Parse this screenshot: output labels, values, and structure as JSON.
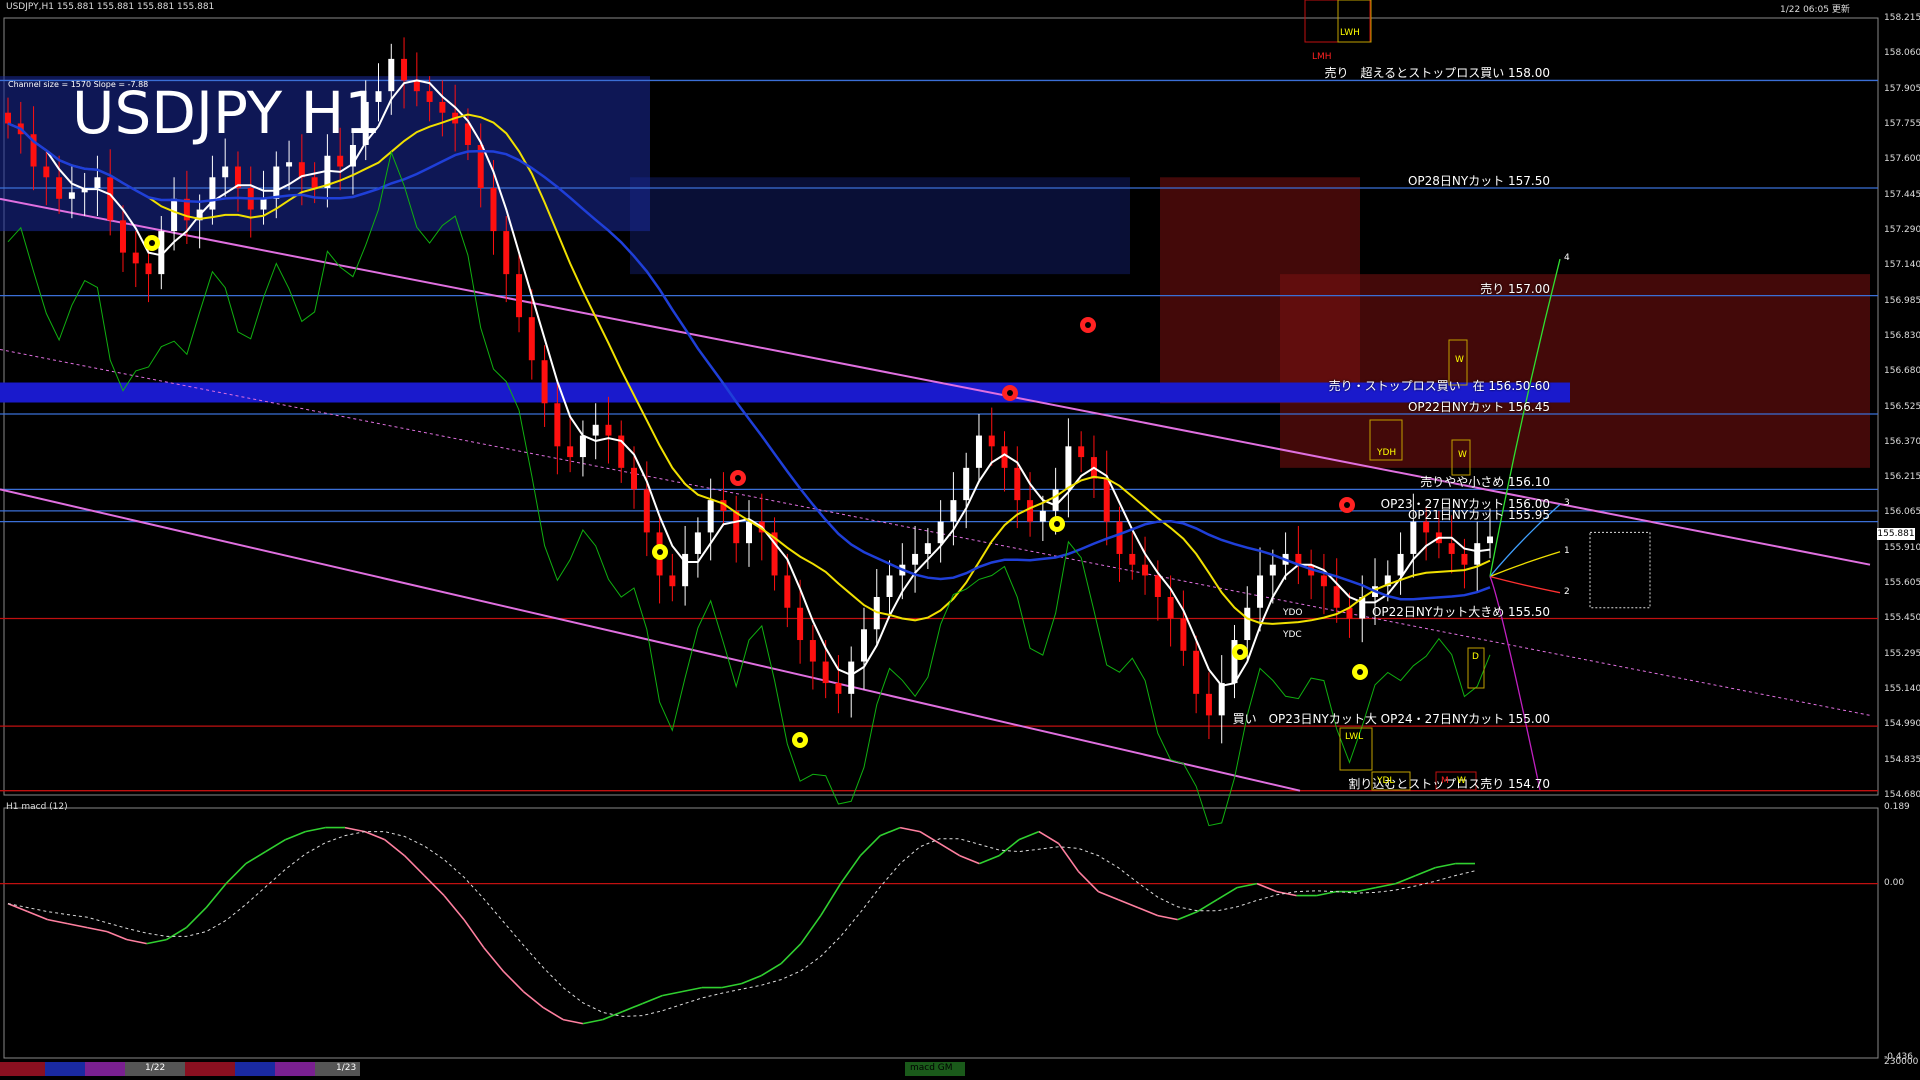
{
  "header": {
    "symbol": "USDJPY,H1  155.881 155.881 155.881 155.881",
    "clock": "1/22 06:05 更新",
    "title": "USDJPY H1",
    "channel_info": "Channel size = 1570 Slope = -7.88",
    "macd_label": "H1  macd (12)"
  },
  "chart_data": {
    "type": "line",
    "title": "USDJPY H1",
    "ylim": [
      154.68,
      158.29
    ],
    "macd_ylim": [
      -0.436,
      0.189
    ],
    "y_ticks": [
      "158.215",
      "158.060",
      "157.905",
      "157.755",
      "157.600",
      "157.445",
      "157.290",
      "157.140",
      "156.985",
      "156.830",
      "156.680",
      "156.525",
      "156.370",
      "156.215",
      "156.065",
      "155.910",
      "155.605",
      "155.450",
      "155.295",
      "155.140",
      "154.990",
      "154.835",
      "154.680"
    ],
    "current_price": "155.881",
    "macd_ticks": [
      "0.189",
      "0.00",
      "-0.436",
      "230000"
    ],
    "close_prices": [
      157.8,
      157.75,
      157.6,
      157.55,
      157.45,
      157.48,
      157.5,
      157.55,
      157.35,
      157.2,
      157.15,
      157.1,
      157.3,
      157.45,
      157.35,
      157.4,
      157.55,
      157.6,
      157.5,
      157.4,
      157.45,
      157.6,
      157.62,
      157.55,
      157.5,
      157.65,
      157.6,
      157.7,
      157.9,
      157.95,
      158.1,
      158.0,
      157.95,
      157.9,
      157.85,
      157.8,
      157.7,
      157.5,
      157.3,
      157.1,
      156.9,
      156.7,
      156.5,
      156.3,
      156.25,
      156.35,
      156.4,
      156.35,
      156.2,
      156.1,
      155.9,
      155.7,
      155.65,
      155.8,
      155.9,
      156.05,
      156.0,
      155.85,
      155.95,
      155.9,
      155.7,
      155.55,
      155.4,
      155.3,
      155.2,
      155.15,
      155.3,
      155.45,
      155.6,
      155.7,
      155.75,
      155.8,
      155.85,
      155.95,
      156.05,
      156.2,
      156.35,
      156.3,
      156.2,
      156.05,
      155.95,
      156.0,
      156.1,
      156.3,
      156.25,
      156.15,
      155.95,
      155.8,
      155.75,
      155.7,
      155.6,
      155.5,
      155.35,
      155.15,
      155.05,
      155.2,
      155.4,
      155.55,
      155.7,
      155.75,
      155.8,
      155.75,
      155.7,
      155.65,
      155.55,
      155.5,
      155.6,
      155.65,
      155.7,
      155.8,
      155.95,
      155.9,
      155.85,
      155.8,
      155.75,
      155.85,
      155.881
    ],
    "macd": [
      -0.05,
      -0.07,
      -0.09,
      -0.1,
      -0.11,
      -0.12,
      -0.14,
      -0.15,
      -0.14,
      -0.11,
      -0.06,
      0.0,
      0.05,
      0.08,
      0.11,
      0.13,
      0.14,
      0.14,
      0.13,
      0.11,
      0.07,
      0.02,
      -0.03,
      -0.09,
      -0.16,
      -0.22,
      -0.27,
      -0.31,
      -0.34,
      -0.35,
      -0.34,
      -0.32,
      -0.3,
      -0.28,
      -0.27,
      -0.26,
      -0.26,
      -0.25,
      -0.23,
      -0.2,
      -0.15,
      -0.08,
      0.0,
      0.07,
      0.12,
      0.14,
      0.13,
      0.1,
      0.07,
      0.05,
      0.07,
      0.11,
      0.13,
      0.1,
      0.03,
      -0.02,
      -0.04,
      -0.06,
      -0.08,
      -0.09,
      -0.07,
      -0.04,
      -0.01,
      0.0,
      -0.02,
      -0.03,
      -0.03,
      -0.02,
      -0.02,
      -0.01,
      0.0,
      0.02,
      0.04,
      0.05,
      0.05
    ]
  },
  "levels": [
    {
      "text": "売り　超えるとストップロス買い 158.00",
      "price": 158.0,
      "color": "#3b6fd6"
    },
    {
      "text": "OP28日NYカット 157.50",
      "price": 157.5,
      "color": "#3b6fd6"
    },
    {
      "text": "売り 157.00",
      "price": 157.0,
      "color": "#3b6fd6"
    },
    {
      "text": "売り・ストップロス買い　在 156.50-60",
      "price": 156.55,
      "color": "#1a1acc"
    },
    {
      "text": "OP22日NYカット 156.45",
      "price": 156.45,
      "color": "#3b6fd6"
    },
    {
      "text": "売りやや小さめ 156.10",
      "price": 156.1,
      "color": "#3b6fd6"
    },
    {
      "text": "OP23・27日NYカット 156.00",
      "price": 156.0,
      "color": "#3b6fd6"
    },
    {
      "text": "OP21日NYカット 155.95",
      "price": 155.95,
      "color": "#3b6fd6"
    },
    {
      "text": "OP22日NYカット大きめ 155.50",
      "price": 155.5,
      "color": "#c01010"
    },
    {
      "text": "買い　OP23日NYカット大 OP24・27日NYカット 155.00",
      "price": 155.0,
      "color": "#c01010"
    },
    {
      "text": "割り込むとストップロス売り 154.70",
      "price": 154.7,
      "color": "#c01010"
    }
  ],
  "box_labels": [
    "LWH",
    "LMH",
    "W",
    "YDH",
    "W",
    "YDO",
    "YDC",
    "D",
    "LWL",
    "YDL",
    "M",
    "W"
  ],
  "forecast_labels": [
    "1",
    "2",
    "3",
    "4"
  ],
  "bottom": {
    "date1": "1/22",
    "date2": "1/23",
    "macd_name": "macd GM"
  },
  "colors": {
    "bull": "#ffffff",
    "bear": "#ff1010",
    "ma_white": "#ffffff",
    "ma_yellow": "#f0e000",
    "ma_blue": "#1f3fd8",
    "channel": "#e070e0",
    "chikou": "#10b010"
  }
}
